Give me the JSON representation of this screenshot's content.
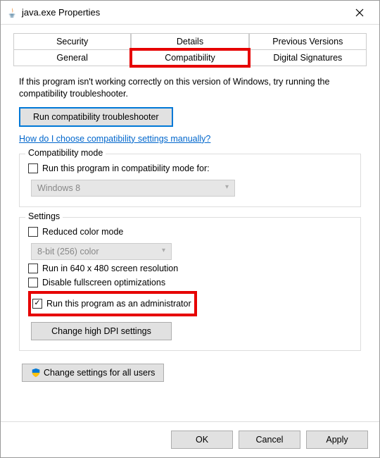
{
  "window": {
    "title": "java.exe Properties"
  },
  "tabs": {
    "row1": [
      "Security",
      "Details",
      "Previous Versions"
    ],
    "row2": [
      "General",
      "Compatibility",
      "Digital Signatures"
    ],
    "active": "Compatibility"
  },
  "intro": {
    "text": "If this program isn't working correctly on this version of Windows, try running the compatibility troubleshooter."
  },
  "buttons": {
    "troubleshooter": "Run compatibility troubleshooter",
    "dpi": "Change high DPI settings",
    "all_users": "Change settings for all users",
    "ok": "OK",
    "cancel": "Cancel",
    "apply": "Apply"
  },
  "link": {
    "manual": "How do I choose compatibility settings manually?"
  },
  "compat_mode": {
    "title": "Compatibility mode",
    "checkbox_label": "Run this program in compatibility mode for:",
    "select_value": "Windows 8"
  },
  "settings": {
    "title": "Settings",
    "reduced_color_label": "Reduced color mode",
    "color_select_value": "8-bit (256) color",
    "run_640_label": "Run in 640 x 480 screen resolution",
    "disable_fullscreen_label": "Disable fullscreen optimizations",
    "run_admin_label": "Run this program as an administrator"
  }
}
